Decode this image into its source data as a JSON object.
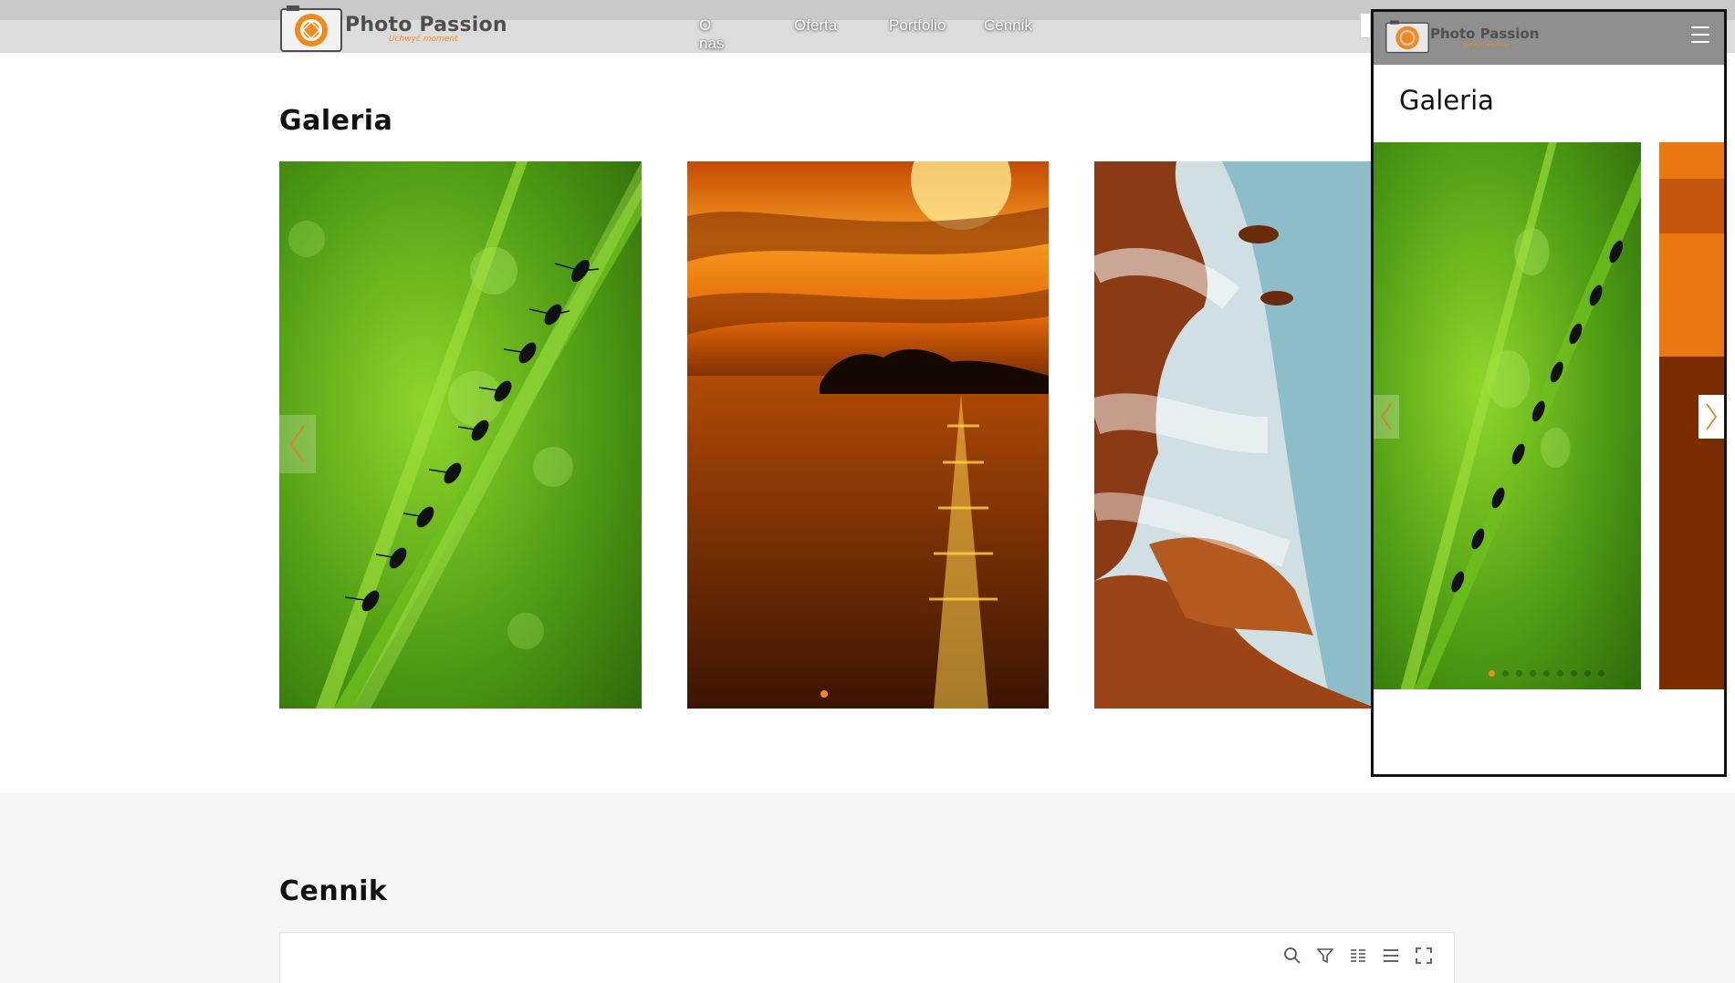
{
  "header": {
    "logo_title": "Photo Passion",
    "logo_tagline": "Uchwyć moment",
    "nav": [
      "O nas",
      "Oferta",
      "Portfolio",
      "Cennik"
    ]
  },
  "gallery": {
    "title": "Galeria",
    "slides": [
      "ants-on-grass",
      "sunset-over-sea",
      "misty-rocky-coast"
    ],
    "active_dot": 1
  },
  "pricing": {
    "title": "Cennik",
    "toolbar": [
      "search-icon",
      "filter-icon",
      "columns-icon",
      "list-icon",
      "fullscreen-icon"
    ]
  },
  "phone_preview": {
    "logo_title": "Photo Passion",
    "logo_tagline": "Uchwyć moment",
    "title": "Galeria",
    "dots_count": 9,
    "active_dot": 1
  },
  "colors": {
    "accent": "#f08a1c",
    "header_bg": "#dcdcdc",
    "phone_header_bg": "#8f8f8f"
  }
}
